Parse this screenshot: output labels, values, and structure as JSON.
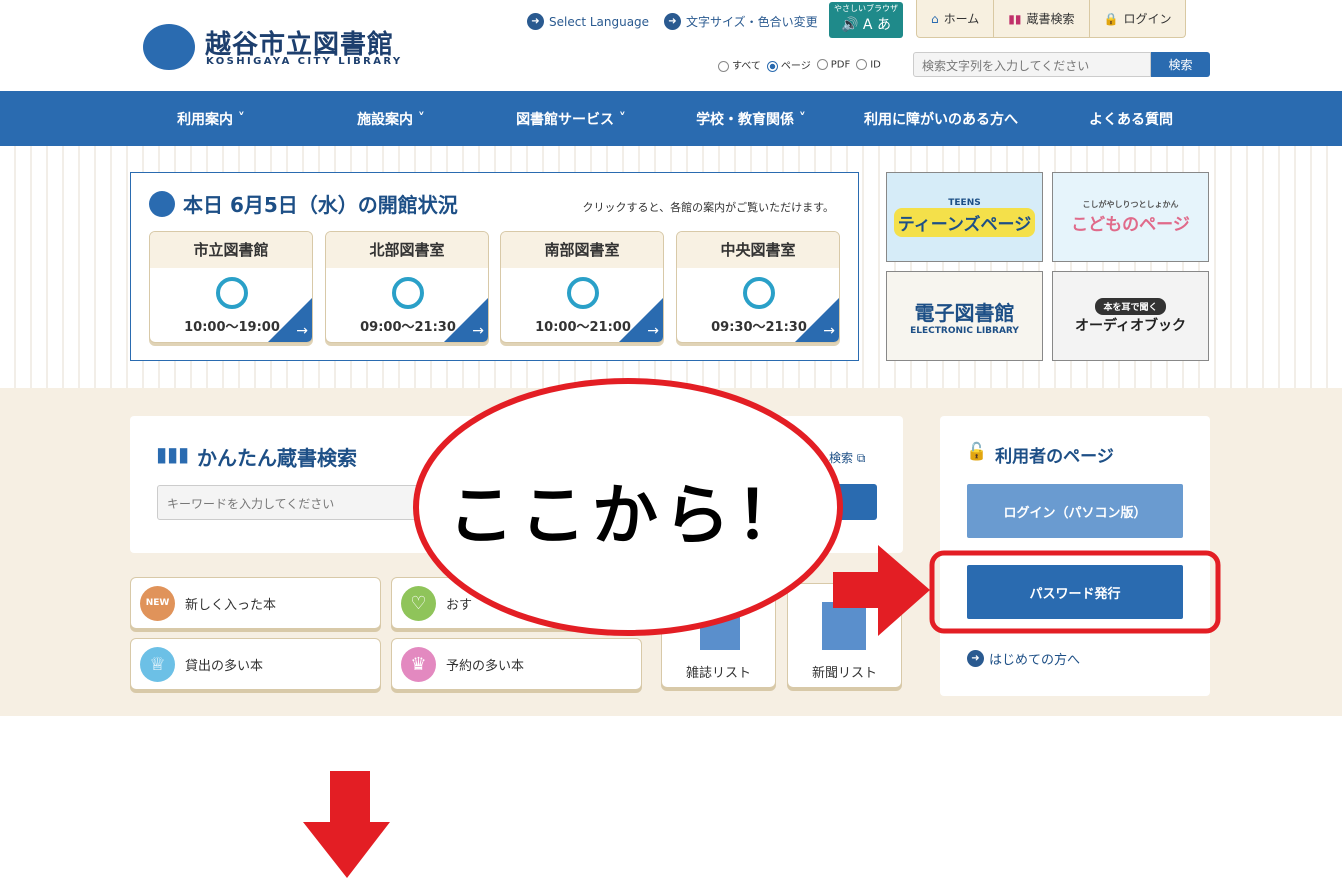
{
  "header": {
    "logo_ja": "越谷市立図書館",
    "logo_en": "KOSHIGAYA CITY LIBRARY",
    "select_language": "Select Language",
    "text_size": "文字サイズ・色合い変更",
    "yasashii": "やさしいブラウザ",
    "tabs": [
      {
        "label": "ホーム",
        "icon": "home-icon"
      },
      {
        "label": "蔵書検索",
        "icon": "books-icon"
      },
      {
        "label": "ログイン",
        "icon": "lock-icon"
      }
    ],
    "search_scope": [
      "すべて",
      "ページ",
      "PDF",
      "ID"
    ],
    "search_scope_selected": "ページ",
    "search_placeholder": "検索文字列を入力してください",
    "search_button": "検索"
  },
  "nav": [
    "利用案内",
    "施設案内",
    "図書館サービス",
    "学校・教育関係",
    "利用に障がいのある方へ",
    "よくある質問"
  ],
  "status": {
    "title": "本日 6月5日（水）の開館状況",
    "note": "クリックすると、各館の案内がご覧いただけます。",
    "libraries": [
      {
        "name": "市立図書館",
        "hours": "10:00〜19:00"
      },
      {
        "name": "北部図書室",
        "hours": "09:00〜21:30"
      },
      {
        "name": "南部図書室",
        "hours": "10:00〜21:00"
      },
      {
        "name": "中央図書室",
        "hours": "09:30〜21:30"
      }
    ]
  },
  "banners": {
    "teens_small": "TEENS",
    "teens": "ティーンズページ",
    "kids_small": "こしがやしりつとしょかん",
    "kids": "こどものページ",
    "ebook": "電子図書館",
    "ebook_en": "ELECTRONIC LIBRARY",
    "audio_small": "本を耳で聞く",
    "audio": "オーディオブック"
  },
  "search": {
    "title": "かんたん蔵書検索",
    "placeholder": "キーワードを入力してください",
    "detail_link": "検索"
  },
  "quick": [
    {
      "label": "新しく入った本",
      "icon": "NEW",
      "color": "#e0935a"
    },
    {
      "label": "おす",
      "icon": "♡",
      "color": "#8fc45a"
    },
    {
      "label": "貸出の多い本",
      "icon": "♕",
      "color": "#6cc0e6"
    },
    {
      "label": "予約の多い本",
      "icon": "♛",
      "color": "#e389c0"
    }
  ],
  "lists": [
    "雑誌リスト",
    "新聞リスト"
  ],
  "user": {
    "title": "利用者のページ",
    "login": "ログイン（パソコン版）",
    "password": "パスワード発行",
    "first": "はじめての方へ"
  },
  "annotation": {
    "callout": "ここから！",
    "color": "#e31e24"
  }
}
